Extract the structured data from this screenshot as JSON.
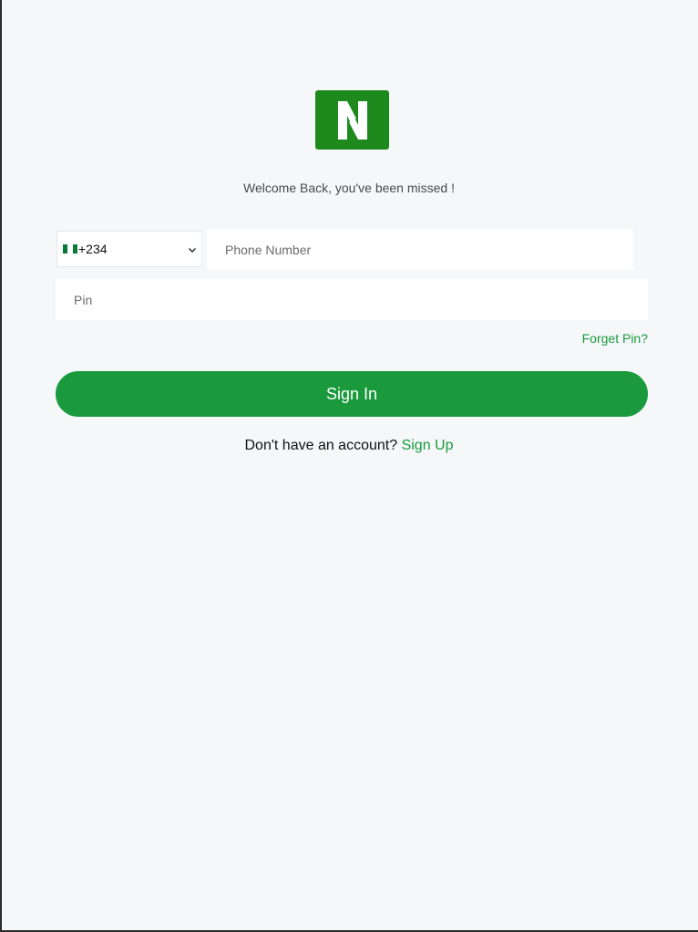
{
  "brand": {
    "logo_icon": "n-logo-icon",
    "logo_color": "#1e8a1e"
  },
  "welcome_text": "Welcome Back, you've been missed !",
  "country": {
    "flag_icon": "nigeria-flag-icon",
    "dial_code": "+234",
    "chevron_icon": "chevron-down-icon"
  },
  "phone": {
    "placeholder": "Phone Number",
    "value": ""
  },
  "pin": {
    "placeholder": "Pin",
    "value": ""
  },
  "forgot_pin_label": "Forget Pin?",
  "signin_label": "Sign In",
  "signup": {
    "prompt": "Don't have an account?",
    "link_label": "Sign Up"
  },
  "colors": {
    "accent": "#1a9a3d",
    "background": "#f5f7f9"
  }
}
